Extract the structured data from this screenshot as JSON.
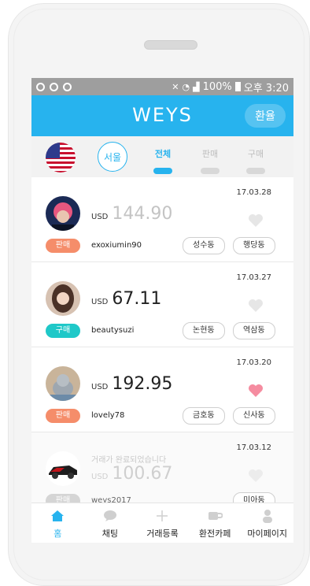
{
  "status_bar": {
    "right_text": "100%",
    "time": "오후 3:20"
  },
  "header": {
    "logo": "WEYS",
    "exchange_button": "환율"
  },
  "filters": {
    "city": "서울",
    "tabs": [
      {
        "label": "전체",
        "active": true
      },
      {
        "label": "판매",
        "active": false
      },
      {
        "label": "구매",
        "active": false
      }
    ]
  },
  "listings": [
    {
      "date": "17.03.28",
      "currency": "USD",
      "amount": "144.90",
      "user": "exoxiumin90",
      "type": "판매",
      "locations": [
        "성수동",
        "행당동"
      ],
      "liked": false
    },
    {
      "date": "17.03.27",
      "currency": "USD",
      "amount": "67.11",
      "user": "beautysuzi",
      "type": "구매",
      "locations": [
        "논현동",
        "역삼동"
      ],
      "liked": false
    },
    {
      "date": "17.03.20",
      "currency": "USD",
      "amount": "192.95",
      "user": "lovely78",
      "type": "판매",
      "locations": [
        "금호동",
        "신사동"
      ],
      "liked": true
    },
    {
      "date": "17.03.12",
      "currency": "USD",
      "amount": "100.67",
      "user": "weys2017",
      "type": "판매",
      "locations": [
        "미아동"
      ],
      "liked": false,
      "done_message": "거래가 완료되었습니다"
    }
  ],
  "nav": [
    {
      "label": "홈",
      "icon": "home-icon",
      "active": true
    },
    {
      "label": "채팅",
      "icon": "chat-icon",
      "active": false
    },
    {
      "label": "거래등록",
      "icon": "plus-icon",
      "active": false
    },
    {
      "label": "환전카페",
      "icon": "cafe-cup-icon",
      "active": false
    },
    {
      "label": "마이페이지",
      "icon": "person-icon",
      "active": false
    }
  ],
  "colors": {
    "primary": "#27b3ee",
    "sell": "#f58d6a",
    "buy": "#1fc8c8",
    "heart_liked": "#f58ca0",
    "heart_default": "#e6e6e6"
  }
}
